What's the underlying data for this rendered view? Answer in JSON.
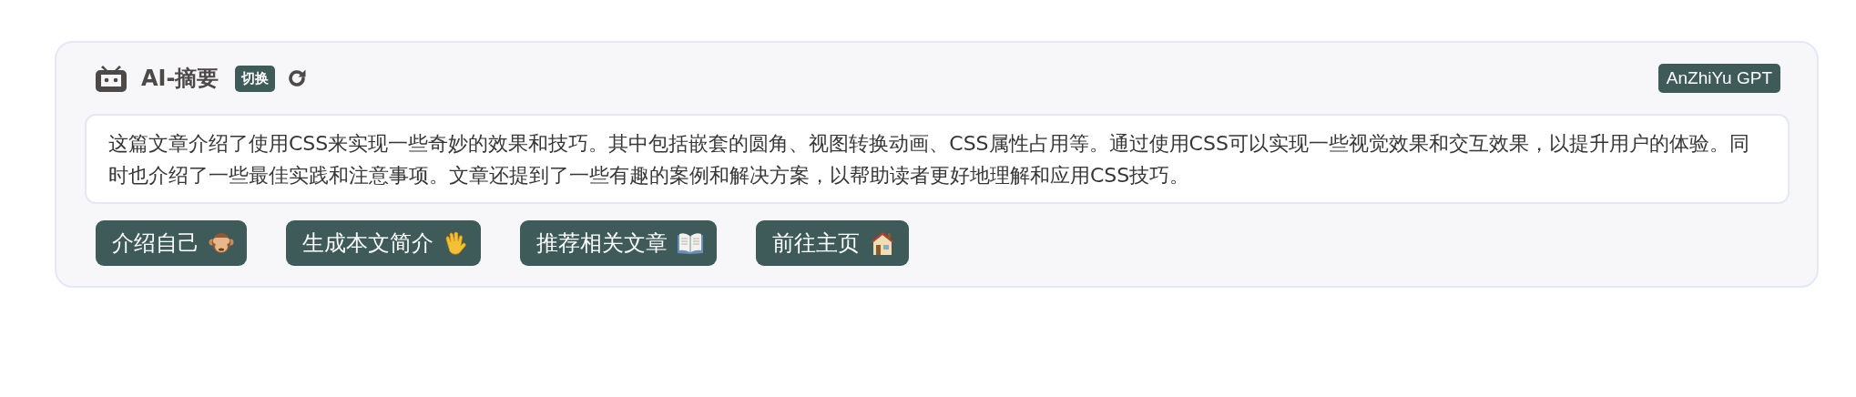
{
  "header": {
    "title": "AI-摘要",
    "switch_tag": "切换",
    "model_tag": "AnZhiYu GPT"
  },
  "summary": "这篇文章介绍了使用CSS来实现一些奇妙的效果和技巧。其中包括嵌套的圆角、视图转换动画、CSS属性占用等。通过使用CSS可以实现一些视觉效果和交互效果，以提升用户的体验。同时也介绍了一些最佳实践和注意事项。文章还提到了一些有趣的案例和解决方案，以帮助读者更好地理解和应用CSS技巧。",
  "buttons": [
    {
      "label": "介绍自己",
      "kind": "monkey"
    },
    {
      "label": "生成本文简介",
      "kind": "wave"
    },
    {
      "label": "推荐相关文章",
      "kind": "book"
    },
    {
      "label": "前往主页",
      "kind": "house"
    }
  ]
}
